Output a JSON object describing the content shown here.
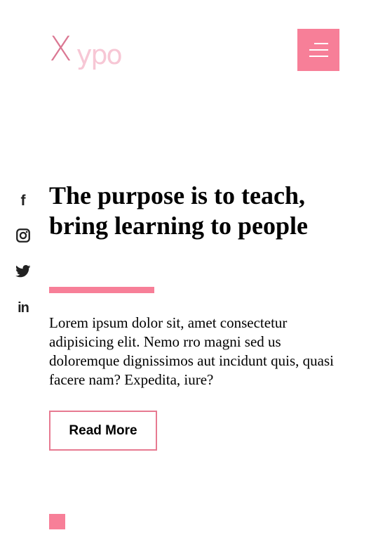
{
  "header": {
    "logo": {
      "initial": "X",
      "rest": "ypo"
    },
    "menu_icon": "hamburger-icon"
  },
  "social": [
    {
      "name": "facebook",
      "icon": "facebook-icon",
      "glyph": "f"
    },
    {
      "name": "instagram",
      "icon": "instagram-icon"
    },
    {
      "name": "twitter",
      "icon": "twitter-icon"
    },
    {
      "name": "linkedin",
      "icon": "linkedin-icon",
      "glyph": "in"
    }
  ],
  "hero": {
    "title": "The purpose is to teach, bring learning to people",
    "text": "Lorem ipsum dolor sit, amet consectetur adipisicing elit. Nemo rro magni sed us doloremque dignissimos aut incidunt quis, quasi facere nam? Expedita, iure?",
    "button_label": "Read More"
  },
  "colors": {
    "accent": "#f77f98",
    "logo_primary": "#db7893",
    "logo_secondary": "#f7c7d5",
    "text": "#000000",
    "icon": "#222222"
  }
}
